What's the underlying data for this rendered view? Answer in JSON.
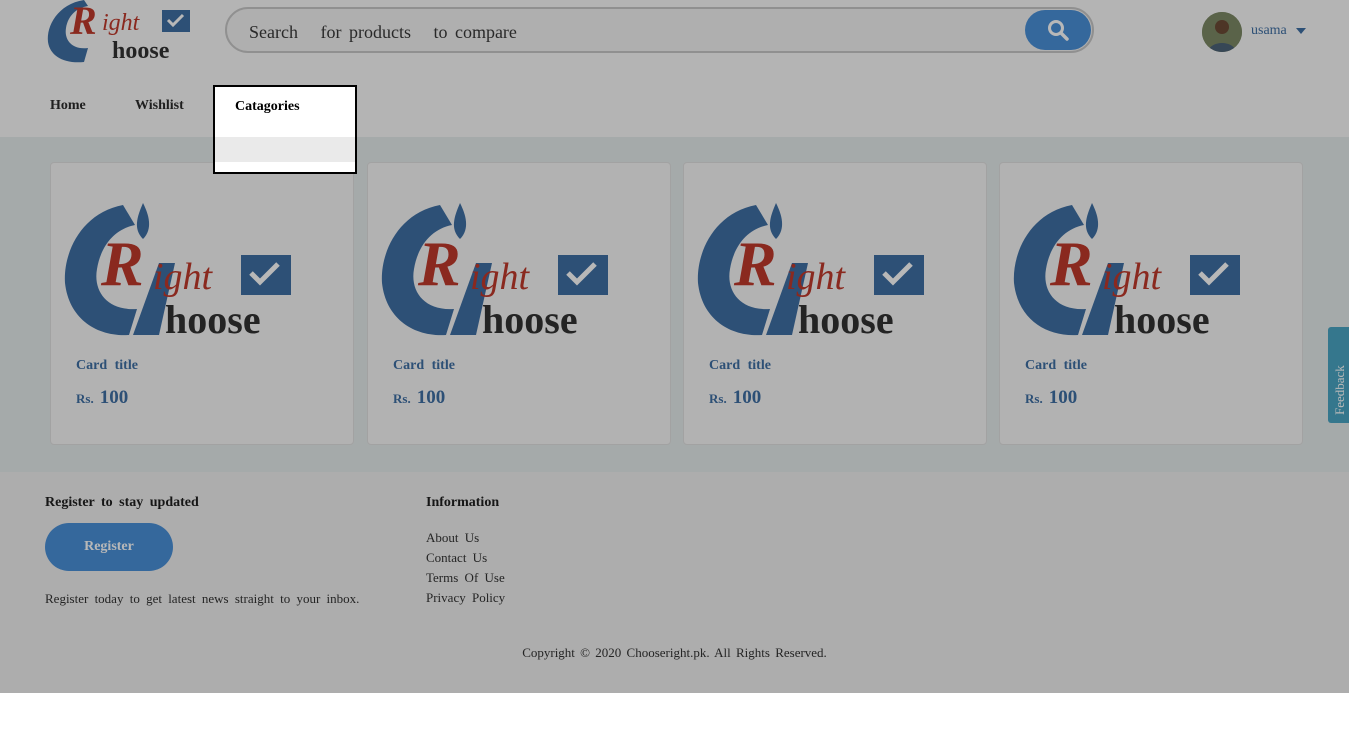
{
  "header": {
    "search": {
      "placeholder": "Search   for products   to compare",
      "button_icon": "search-icon"
    },
    "user": {
      "name": "usama",
      "caret_icon": "caret-down-icon"
    }
  },
  "nav": {
    "items": [
      {
        "label": "Home"
      },
      {
        "label": "Wishlist"
      }
    ],
    "dropdown": {
      "title": "Catagories"
    }
  },
  "products": [
    {
      "title": "Card   title",
      "currency": "Rs.",
      "price": "100"
    },
    {
      "title": "Card   title",
      "currency": "Rs.",
      "price": "100"
    },
    {
      "title": "Card   title",
      "currency": "Rs.",
      "price": "100"
    },
    {
      "title": "Card   title",
      "currency": "Rs.",
      "price": "100"
    }
  ],
  "feedback": {
    "label": "Feedback"
  },
  "footer": {
    "register_heading": "Register   to stay  updated",
    "register_button": "Register",
    "register_text": "Register  today  to get  latest  news  straight  to your inbox.",
    "info_heading": "Information",
    "links": [
      "About Us",
      "Contact   Us",
      "Terms  Of Use",
      "Privacy  Policy"
    ],
    "copyright": "Copyright  ©  2020  Chooseright.pk.    All Rights  Reserved."
  },
  "colors": {
    "accent": "#4a90d9",
    "brand_blue": "#3f6fa4",
    "brand_red": "#c0392b"
  }
}
